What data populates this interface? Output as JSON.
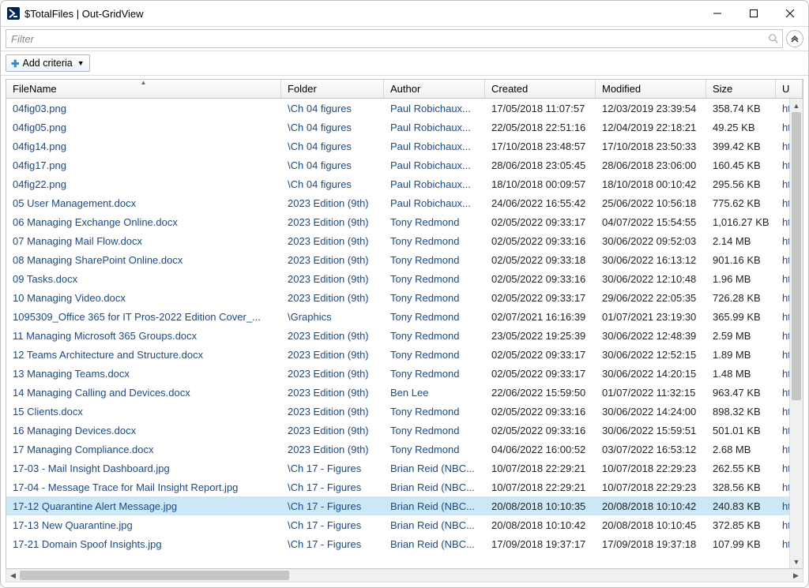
{
  "window": {
    "title": "$TotalFiles | Out-GridView"
  },
  "filter": {
    "placeholder": "Filter"
  },
  "criteria": {
    "add_label": "Add criteria"
  },
  "columns": {
    "filename": "FileName",
    "folder": "Folder",
    "author": "Author",
    "created": "Created",
    "modified": "Modified",
    "size": "Size",
    "extra": "U"
  },
  "selected_index": 21,
  "rows": [
    {
      "filename": "04fig03.png",
      "folder": "\\Ch 04 figures",
      "author": "Paul Robichaux...",
      "created": "17/05/2018 11:07:57",
      "modified": "12/03/2019 23:39:54",
      "size": "358.74 KB",
      "extra": "ht"
    },
    {
      "filename": "04fig05.png",
      "folder": "\\Ch 04 figures",
      "author": "Paul Robichaux...",
      "created": "22/05/2018 22:51:16",
      "modified": "12/04/2019 22:18:21",
      "size": "49.25 KB",
      "extra": "ht"
    },
    {
      "filename": "04fig14.png",
      "folder": "\\Ch 04 figures",
      "author": "Paul Robichaux...",
      "created": "17/10/2018 23:48:57",
      "modified": "17/10/2018 23:50:33",
      "size": "399.42 KB",
      "extra": "ht"
    },
    {
      "filename": "04fig17.png",
      "folder": "\\Ch 04 figures",
      "author": "Paul Robichaux...",
      "created": "28/06/2018 23:05:45",
      "modified": "28/06/2018 23:06:00",
      "size": "160.45 KB",
      "extra": "ht"
    },
    {
      "filename": "04fig22.png",
      "folder": "\\Ch 04 figures",
      "author": "Paul Robichaux...",
      "created": "18/10/2018 00:09:57",
      "modified": "18/10/2018 00:10:42",
      "size": "295.56 KB",
      "extra": "ht"
    },
    {
      "filename": "05 User Management.docx",
      "folder": "2023 Edition (9th)",
      "author": "Paul Robichaux...",
      "created": "24/06/2022 16:55:42",
      "modified": "25/06/2022 10:56:18",
      "size": "775.62 KB",
      "extra": "ht"
    },
    {
      "filename": "06 Managing Exchange Online.docx",
      "folder": "2023 Edition (9th)",
      "author": "Tony Redmond",
      "created": "02/05/2022 09:33:17",
      "modified": "04/07/2022 15:54:55",
      "size": "1,016.27 KB",
      "extra": "ht"
    },
    {
      "filename": "07 Managing Mail Flow.docx",
      "folder": "2023 Edition (9th)",
      "author": "Tony Redmond",
      "created": "02/05/2022 09:33:16",
      "modified": "30/06/2022 09:52:03",
      "size": "2.14 MB",
      "extra": "ht"
    },
    {
      "filename": "08 Managing SharePoint Online.docx",
      "folder": "2023 Edition (9th)",
      "author": "Tony Redmond",
      "created": "02/05/2022 09:33:18",
      "modified": "30/06/2022 16:13:12",
      "size": "901.16 KB",
      "extra": "ht"
    },
    {
      "filename": "09 Tasks.docx",
      "folder": "2023 Edition (9th)",
      "author": "Tony Redmond",
      "created": "02/05/2022 09:33:16",
      "modified": "30/06/2022 12:10:48",
      "size": "1.96 MB",
      "extra": "ht"
    },
    {
      "filename": "10 Managing Video.docx",
      "folder": "2023 Edition (9th)",
      "author": "Tony Redmond",
      "created": "02/05/2022 09:33:17",
      "modified": "29/06/2022 22:05:35",
      "size": "726.28 KB",
      "extra": "ht"
    },
    {
      "filename": "1095309_Office 365 for IT Pros-2022 Edition Cover_...",
      "folder": "\\Graphics",
      "author": "Tony Redmond",
      "created": "02/07/2021 16:16:39",
      "modified": "01/07/2021 23:19:30",
      "size": "365.99 KB",
      "extra": "ht"
    },
    {
      "filename": "11 Managing Microsoft 365 Groups.docx",
      "folder": "2023 Edition (9th)",
      "author": "Tony Redmond",
      "created": "23/05/2022 19:25:39",
      "modified": "30/06/2022 12:48:39",
      "size": "2.59 MB",
      "extra": "ht"
    },
    {
      "filename": "12 Teams Architecture and Structure.docx",
      "folder": "2023 Edition (9th)",
      "author": "Tony Redmond",
      "created": "02/05/2022 09:33:17",
      "modified": "30/06/2022 12:52:15",
      "size": "1.89 MB",
      "extra": "ht"
    },
    {
      "filename": "13 Managing Teams.docx",
      "folder": "2023 Edition (9th)",
      "author": "Tony Redmond",
      "created": "02/05/2022 09:33:17",
      "modified": "30/06/2022 14:20:15",
      "size": "1.48 MB",
      "extra": "ht"
    },
    {
      "filename": "14 Managing Calling and Devices.docx",
      "folder": "2023 Edition (9th)",
      "author": "Ben Lee",
      "created": "22/06/2022 15:59:50",
      "modified": "01/07/2022 11:32:15",
      "size": "963.47 KB",
      "extra": "ht"
    },
    {
      "filename": "15 Clients.docx",
      "folder": "2023 Edition (9th)",
      "author": "Tony Redmond",
      "created": "02/05/2022 09:33:16",
      "modified": "30/06/2022 14:24:00",
      "size": "898.32 KB",
      "extra": "ht"
    },
    {
      "filename": "16 Managing Devices.docx",
      "folder": "2023 Edition (9th)",
      "author": "Tony Redmond",
      "created": "02/05/2022 09:33:16",
      "modified": "30/06/2022 15:59:51",
      "size": "501.01 KB",
      "extra": "ht"
    },
    {
      "filename": "17 Managing Compliance.docx",
      "folder": "2023 Edition (9th)",
      "author": "Tony Redmond",
      "created": "04/06/2022 16:00:52",
      "modified": "03/07/2022 16:53:12",
      "size": "2.68 MB",
      "extra": "ht"
    },
    {
      "filename": "17-03 - Mail Insight Dashboard.jpg",
      "folder": "\\Ch 17 - Figures",
      "author": "Brian Reid (NBC...",
      "created": "10/07/2018 22:29:21",
      "modified": "10/07/2018 22:29:23",
      "size": "262.55 KB",
      "extra": "ht"
    },
    {
      "filename": "17-04 - Message Trace for Mail Insight Report.jpg",
      "folder": "\\Ch 17 - Figures",
      "author": "Brian Reid (NBC...",
      "created": "10/07/2018 22:29:21",
      "modified": "10/07/2018 22:29:23",
      "size": "328.56 KB",
      "extra": "ht"
    },
    {
      "filename": "17-12 Quarantine Alert Message.jpg",
      "folder": "\\Ch 17 - Figures",
      "author": "Brian Reid (NBC...",
      "created": "20/08/2018 10:10:35",
      "modified": "20/08/2018 10:10:42",
      "size": "240.83 KB",
      "extra": "ht"
    },
    {
      "filename": "17-13 New Quarantine.jpg",
      "folder": "\\Ch 17 - Figures",
      "author": "Brian Reid (NBC...",
      "created": "20/08/2018 10:10:42",
      "modified": "20/08/2018 10:10:45",
      "size": "372.85 KB",
      "extra": "ht"
    },
    {
      "filename": "17-21 Domain Spoof Insights.jpg",
      "folder": "\\Ch 17 - Figures",
      "author": "Brian Reid (NBC...",
      "created": "17/09/2018 19:37:17",
      "modified": "17/09/2018 19:37:18",
      "size": "107.99 KB",
      "extra": "ht"
    }
  ]
}
